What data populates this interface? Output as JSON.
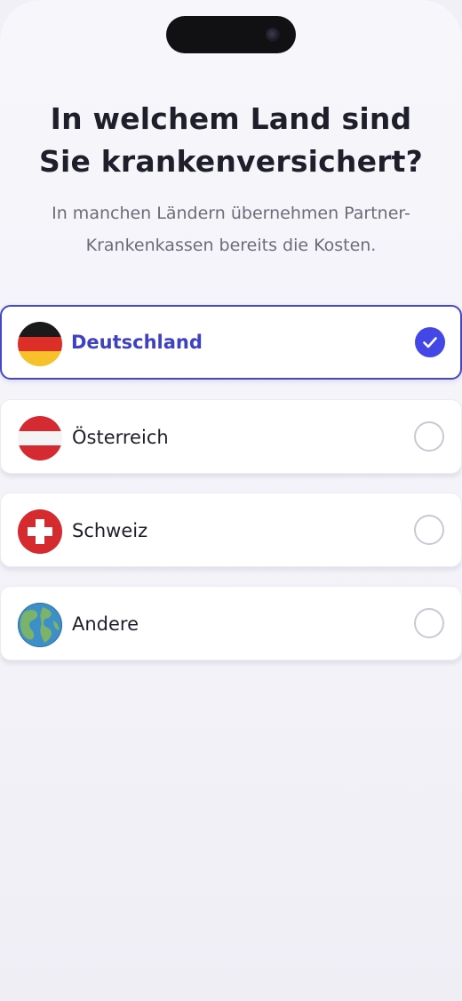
{
  "header": {
    "title": "In welchem Land sind Sie krankenversichert?",
    "subtitle": "In manchen Ländern übernehmen Partner-Krankenkassen bereits die Kosten."
  },
  "options": [
    {
      "label": "Deutschland",
      "icon": "germany-flag-icon",
      "selected": true
    },
    {
      "label": "Österreich",
      "icon": "austria-flag-icon",
      "selected": false
    },
    {
      "label": "Schweiz",
      "icon": "switzerland-flag-icon",
      "selected": false
    },
    {
      "label": "Andere",
      "icon": "globe-icon",
      "selected": false
    }
  ],
  "colors": {
    "accent": "#4347e6",
    "accent_text": "#3d41c2",
    "background": "#f3f2f8",
    "title": "#1f1f2b",
    "subtitle": "#6c6c78"
  }
}
